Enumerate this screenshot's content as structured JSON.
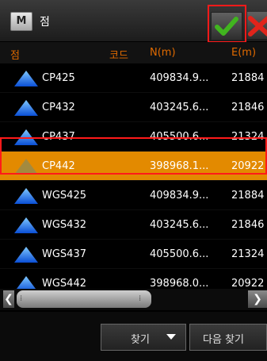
{
  "window": {
    "title": "점",
    "title_icon_letter": "M",
    "ok_icon": "check-icon",
    "cancel_icon": "close-icon"
  },
  "table": {
    "columns": [
      "점",
      "코드",
      "N(m)",
      "E(m)"
    ],
    "rows": [
      {
        "name": "CP425",
        "code": "",
        "n": "409834.9...",
        "e": "21884",
        "selected": false
      },
      {
        "name": "CP432",
        "code": "",
        "n": "403245.6...",
        "e": "21846",
        "selected": false
      },
      {
        "name": "CP437",
        "code": "",
        "n": "405500.6...",
        "e": "21324",
        "selected": false
      },
      {
        "name": "CP442",
        "code": "",
        "n": "398968.1...",
        "e": "20922",
        "selected": true
      },
      {
        "name": "WGS425",
        "code": "",
        "n": "409834.9...",
        "e": "21884",
        "selected": false
      },
      {
        "name": "WGS432",
        "code": "",
        "n": "403245.6...",
        "e": "21846",
        "selected": false
      },
      {
        "name": "WGS437",
        "code": "",
        "n": "405500.6...",
        "e": "21324",
        "selected": false
      },
      {
        "name": "WGS442",
        "code": "",
        "n": "398968.0...",
        "e": "20922",
        "selected": false
      }
    ]
  },
  "scrollbar": {
    "left_arrow": "❮",
    "right_arrow": "❯"
  },
  "buttons": {
    "find_label": "찾기",
    "find_next_label": "다음 찾기"
  },
  "colors": {
    "header_text": "#e06a00",
    "selected_row": "#e38a00",
    "highlight_box": "#ff1a1a"
  }
}
